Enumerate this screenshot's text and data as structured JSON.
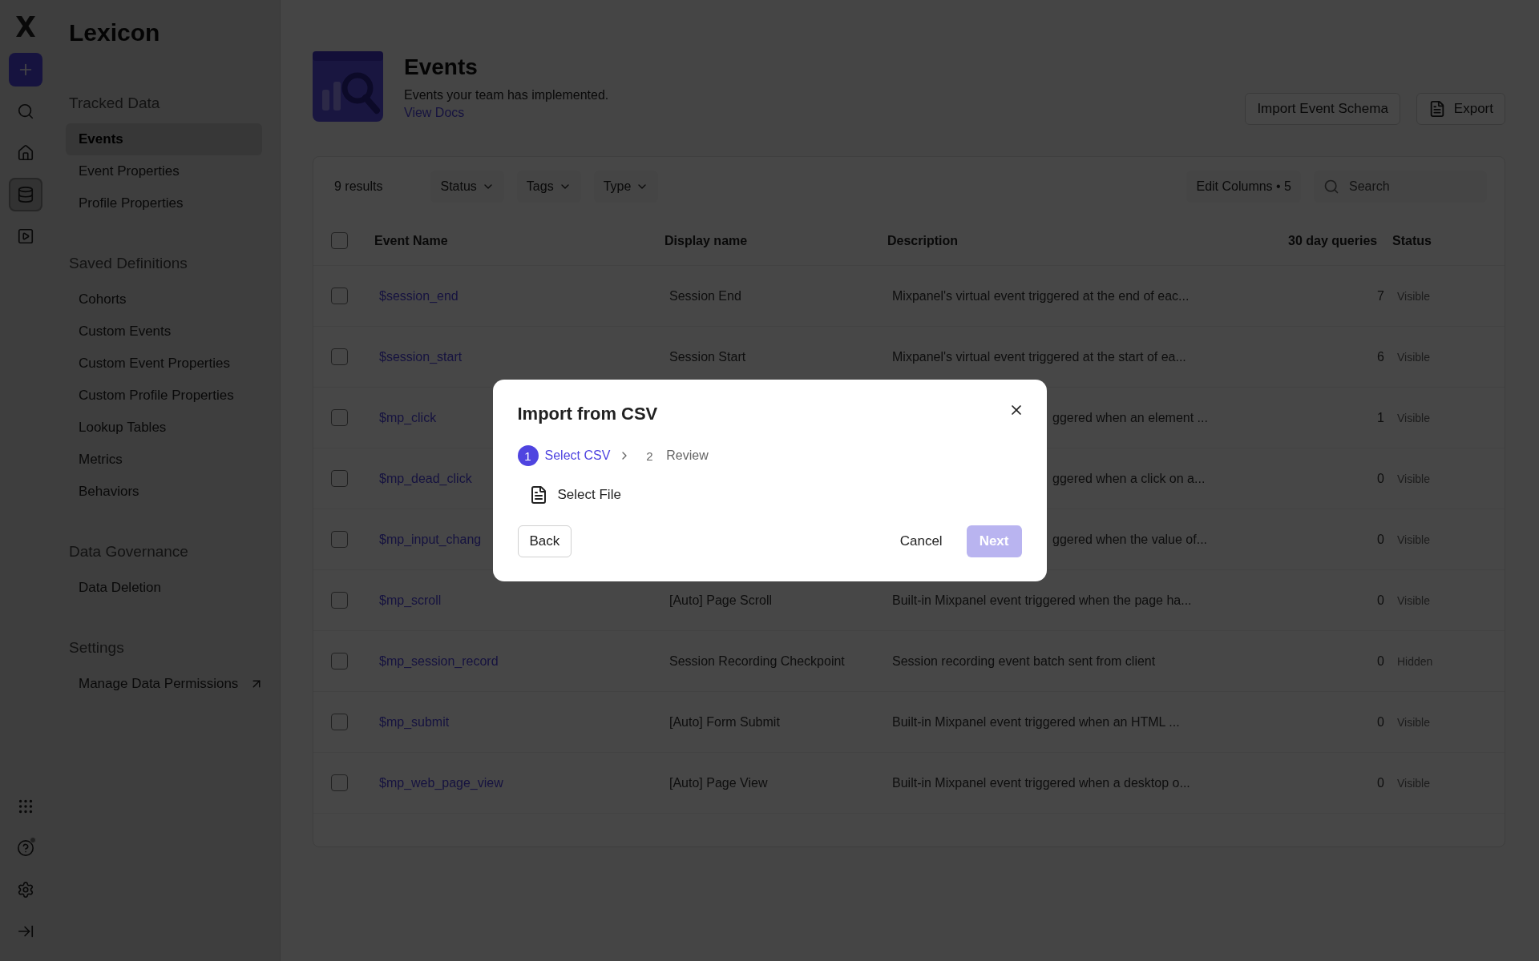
{
  "rail": {
    "items": [
      {
        "kind": "create",
        "selected": false
      },
      {
        "kind": "search",
        "selected": false
      },
      {
        "kind": "home",
        "selected": false
      },
      {
        "kind": "data",
        "selected": true
      },
      {
        "kind": "replay",
        "selected": false
      }
    ],
    "bottom": [
      {
        "kind": "apps",
        "notification": false
      },
      {
        "kind": "help",
        "notification": true
      },
      {
        "kind": "settings",
        "notification": false
      },
      {
        "kind": "collapse",
        "notification": false
      }
    ]
  },
  "sidebar": {
    "title": "Lexicon",
    "groups": [
      {
        "title": "Tracked Data",
        "items": [
          {
            "label": "Events",
            "selected": true,
            "external": false
          },
          {
            "label": "Event Properties",
            "selected": false,
            "external": false
          },
          {
            "label": "Profile Properties",
            "selected": false,
            "external": false
          }
        ]
      },
      {
        "title": "Saved Definitions",
        "items": [
          {
            "label": "Cohorts",
            "selected": false,
            "external": false
          },
          {
            "label": "Custom Events",
            "selected": false,
            "external": false
          },
          {
            "label": "Custom Event Properties",
            "selected": false,
            "external": false
          },
          {
            "label": "Custom Profile Properties",
            "selected": false,
            "external": false
          },
          {
            "label": "Lookup Tables",
            "selected": false,
            "external": false
          },
          {
            "label": "Metrics",
            "selected": false,
            "external": false
          },
          {
            "label": "Behaviors",
            "selected": false,
            "external": false
          }
        ]
      },
      {
        "title": "Data Governance",
        "items": [
          {
            "label": "Data Deletion",
            "selected": false,
            "external": false
          }
        ]
      },
      {
        "title": "Settings",
        "items": [
          {
            "label": "Manage Data Permissions",
            "selected": false,
            "external": true
          }
        ]
      }
    ]
  },
  "header": {
    "title": "Events",
    "subtitle": "Events your team has implemented.",
    "link": "View Docs",
    "actions": [
      {
        "label": "Import Event Schema",
        "kind": "plain"
      },
      {
        "label": "Export",
        "kind": "file"
      }
    ]
  },
  "toolbar": {
    "results": "9 results",
    "filters": [
      "Status",
      "Tags",
      "Type"
    ],
    "edit_columns": "Edit Columns • 5",
    "search_placeholder": "Search"
  },
  "table": {
    "all_checked": false,
    "columns": [
      "Event Name",
      "Display name",
      "Description",
      "30 day queries",
      "Status"
    ],
    "rows": [
      {
        "name": "$session_end",
        "display": "Session End",
        "description": "Mixpanel's virtual event triggered at the end of eac...",
        "queries": "7",
        "status": "Visible",
        "checked": false,
        "covered": false
      },
      {
        "name": "$session_start",
        "display": "Session Start",
        "description": "Mixpanel's virtual event triggered at the start of ea...",
        "queries": "6",
        "status": "Visible",
        "checked": false,
        "covered": false
      },
      {
        "name": "$mp_click",
        "description": "ggered when an element ...",
        "queries": "1",
        "status": "Visible",
        "checked": false,
        "covered": true
      },
      {
        "name": "$mp_dead_click",
        "description": "ggered when a click on a...",
        "queries": "0",
        "status": "Visible",
        "checked": false,
        "covered": true
      },
      {
        "name": "$mp_input_chang",
        "description": "ggered when the value of...",
        "queries": "0",
        "status": "Visible",
        "checked": false,
        "covered": true
      },
      {
        "name": "$mp_scroll",
        "display": "[Auto] Page Scroll",
        "description": "Built-in Mixpanel event triggered when the page ha...",
        "queries": "0",
        "status": "Visible",
        "checked": false,
        "covered": false
      },
      {
        "name": "$mp_session_record",
        "display": "Session Recording Checkpoint",
        "description": "Session recording event batch sent from client",
        "queries": "0",
        "status": "Hidden",
        "checked": false,
        "covered": false
      },
      {
        "name": "$mp_submit",
        "display": "[Auto] Form Submit",
        "description": "Built-in Mixpanel event triggered when an HTML ...",
        "queries": "0",
        "status": "Visible",
        "checked": false,
        "covered": false
      },
      {
        "name": "$mp_web_page_view",
        "display": "[Auto] Page View",
        "description": "Built-in Mixpanel event triggered when a desktop o...",
        "queries": "0",
        "status": "Visible",
        "checked": false,
        "covered": false
      }
    ]
  },
  "modal": {
    "title": "Import from CSV",
    "steps": [
      {
        "number": "1",
        "label": "Select CSV",
        "selected": true
      },
      {
        "number": "2",
        "label": "Review",
        "selected": false
      }
    ],
    "file_button": "Select File",
    "back": "Back",
    "cancel": "Cancel",
    "next": {
      "label": "Next",
      "disabled": true
    }
  }
}
